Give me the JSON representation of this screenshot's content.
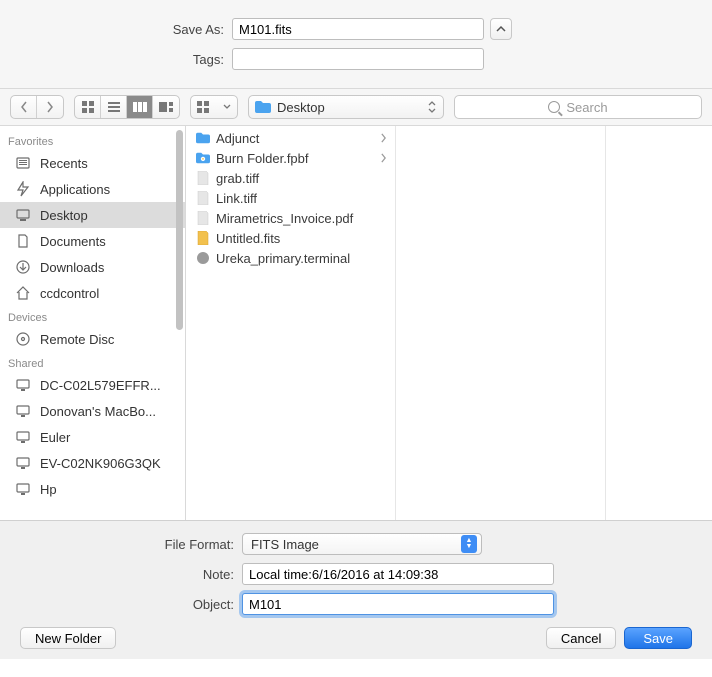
{
  "header": {
    "save_as_label": "Save As:",
    "save_as_value": "M101.fits",
    "tags_label": "Tags:",
    "tags_value": ""
  },
  "toolbar": {
    "location_label": "Desktop",
    "search_placeholder": "Search"
  },
  "sidebar": {
    "sections": [
      {
        "title": "Favorites",
        "items": [
          {
            "label": "Recents",
            "icon": "recents"
          },
          {
            "label": "Applications",
            "icon": "apps"
          },
          {
            "label": "Desktop",
            "icon": "desktop",
            "selected": true
          },
          {
            "label": "Documents",
            "icon": "documents"
          },
          {
            "label": "Downloads",
            "icon": "downloads"
          },
          {
            "label": "ccdcontrol",
            "icon": "home"
          }
        ]
      },
      {
        "title": "Devices",
        "items": [
          {
            "label": "Remote Disc",
            "icon": "disc"
          }
        ]
      },
      {
        "title": "Shared",
        "items": [
          {
            "label": "DC-C02L579EFFR...",
            "icon": "monitor"
          },
          {
            "label": "Donovan's MacBo...",
            "icon": "monitor"
          },
          {
            "label": "Euler",
            "icon": "monitor"
          },
          {
            "label": "EV-C02NK906G3QK",
            "icon": "monitor"
          },
          {
            "label": "Hp",
            "icon": "monitor"
          }
        ]
      }
    ]
  },
  "files": [
    {
      "name": "Adjunct",
      "icon": "folder",
      "has_children": true
    },
    {
      "name": "Burn Folder.fpbf",
      "icon": "burn",
      "has_children": true
    },
    {
      "name": "grab.tiff",
      "icon": "image"
    },
    {
      "name": "Link.tiff",
      "icon": "image"
    },
    {
      "name": "Mirametrics_Invoice.pdf",
      "icon": "pdf"
    },
    {
      "name": "Untitled.fits",
      "icon": "fits"
    },
    {
      "name": "Ureka_primary.terminal",
      "icon": "terminal"
    }
  ],
  "bottom": {
    "format_label": "File Format:",
    "format_value": "FITS Image",
    "note_label": "Note:",
    "note_value": "Local time:6/16/2016 at 14:09:38",
    "object_label": "Object:",
    "object_value": "M101"
  },
  "buttons": {
    "new_folder": "New Folder",
    "cancel": "Cancel",
    "save": "Save"
  }
}
